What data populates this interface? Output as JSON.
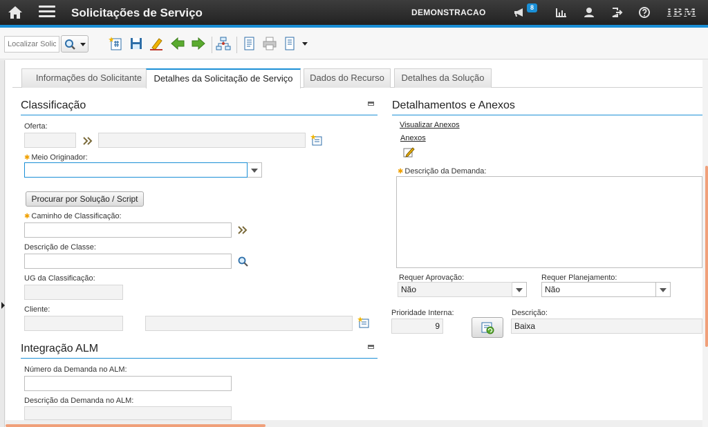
{
  "header": {
    "app_title": "Solicitações de Serviço",
    "user": "DEMONSTRACAO",
    "notification_count": "8",
    "brand": "IBM"
  },
  "toolbar": {
    "search_placeholder": "Localizar Solicitação"
  },
  "tabs": [
    {
      "label": "Informações do Solicitante"
    },
    {
      "label": "Detalhes da Solicitação de Serviço"
    },
    {
      "label": "Dados do Recurso"
    },
    {
      "label": "Detalhes da Solução"
    }
  ],
  "classificacao": {
    "title": "Classificação",
    "oferta_label": "Oferta:",
    "meio_originador_label": "Meio Originador:",
    "procurar_button": "Procurar por Solução / Script",
    "caminho_label": "Caminho de Classificação:",
    "descricao_classe_label": "Descrição de Classe:",
    "ug_label": "UG da Classificação:",
    "cliente_label": "Cliente:"
  },
  "integracao": {
    "title": "Integração ALM",
    "numero_label": "Número da Demanda no ALM:",
    "descricao_label": "Descrição da Demanda no ALM:"
  },
  "detalhamentos": {
    "title": "Detalhamentos e Anexos",
    "visualizar_anexos": "Visualizar Anexos",
    "anexos": "Anexos",
    "descricao_demanda_label": "Descrição da Demanda:",
    "requer_aprovacao_label": "Requer Aprovação:",
    "requer_aprovacao_value": "Não",
    "requer_planejamento_label": "Requer Planejamento:",
    "requer_planejamento_value": "Não",
    "prioridade_label": "Prioridade Interna:",
    "prioridade_value": "9",
    "descricao_label": "Descrição:",
    "descricao_value": "Baixa"
  }
}
